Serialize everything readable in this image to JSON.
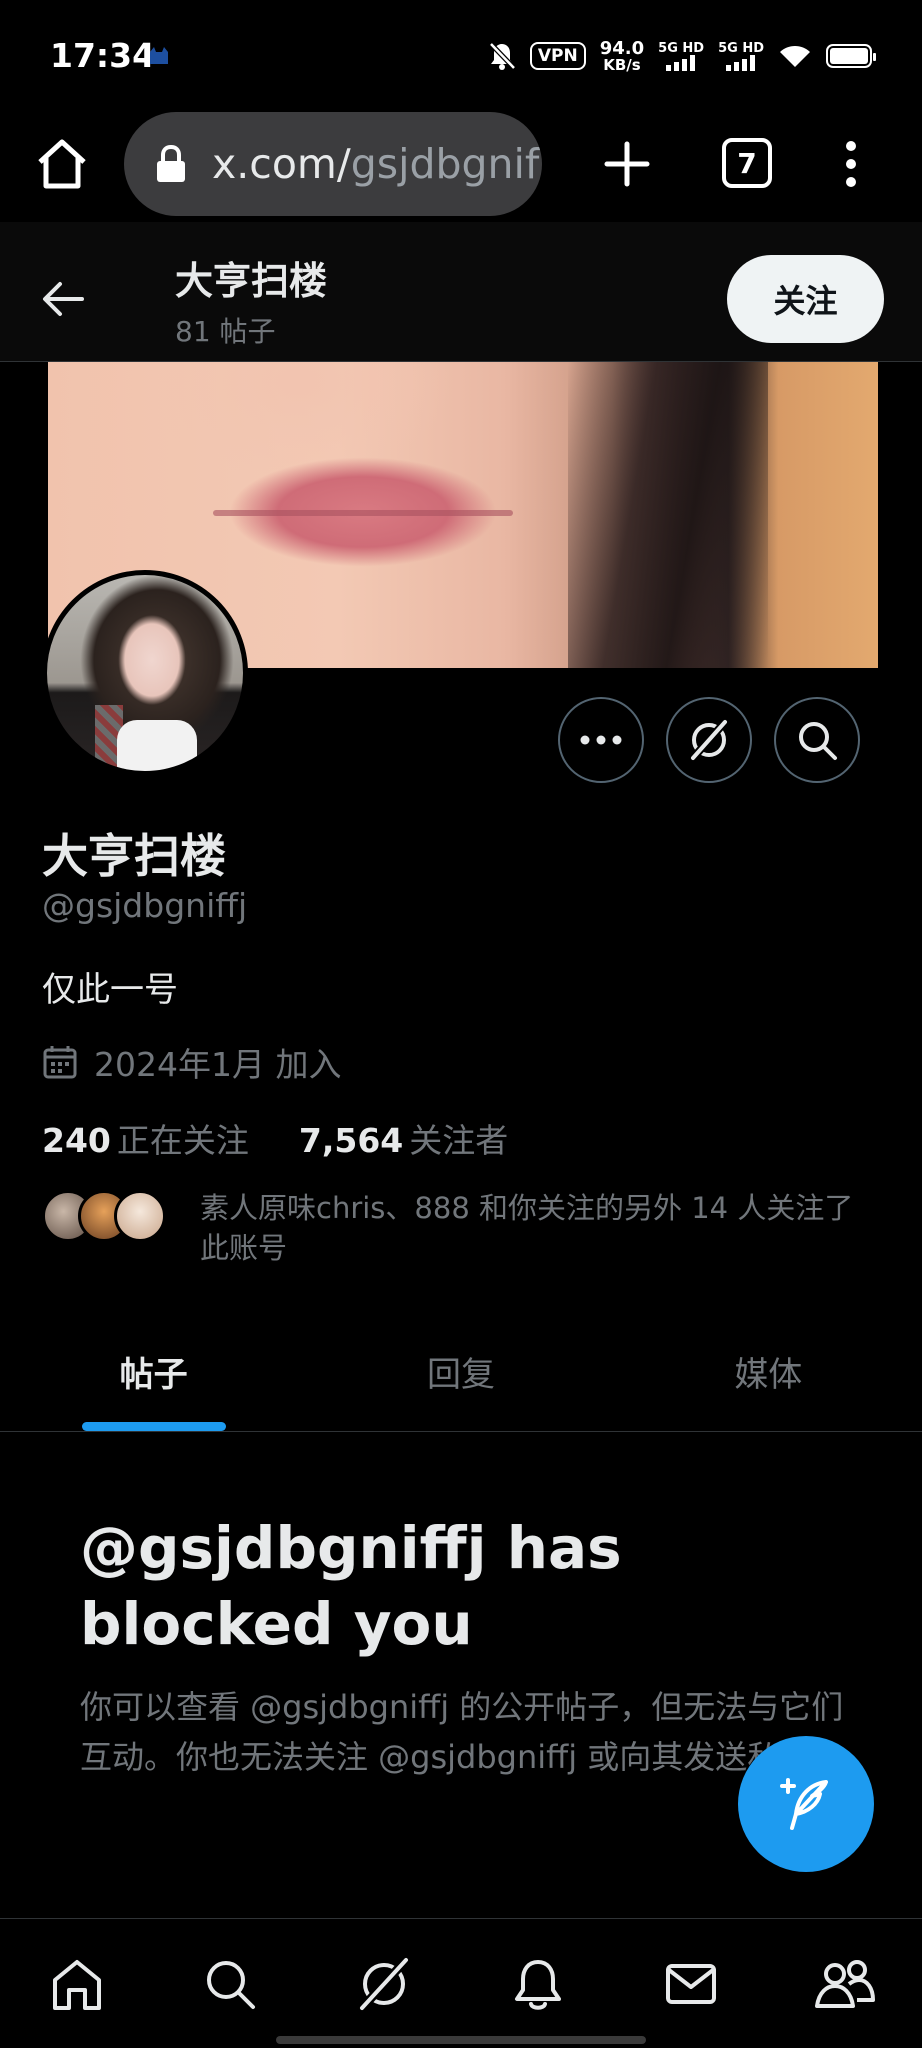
{
  "status_bar": {
    "time": "17:34",
    "vpn": "VPN",
    "speed_value": "94.0",
    "speed_unit": "KB/s",
    "signal1": "5G HD",
    "signal2": "5G HD"
  },
  "browser": {
    "url_host": "x.com/",
    "url_path": "gsjdbgnif",
    "tab_count": "7"
  },
  "header": {
    "name": "大亨扫楼",
    "posts_count": "81 帖子",
    "follow_label": "关注"
  },
  "profile": {
    "name": "大亨扫楼",
    "handle": "@gsjdbgniffj",
    "bio": "仅此一号",
    "joined": "2024年1月 加入",
    "following_count": "240",
    "following_label": "正在关注",
    "followers_count": "7,564",
    "followers_label": "关注者",
    "followed_by_text": "素人原味chris、888 和你关注的另外 14 人关注了此账号"
  },
  "tabs": [
    {
      "label": "帖子",
      "active": true
    },
    {
      "label": "回复",
      "active": false
    },
    {
      "label": "媒体",
      "active": false
    }
  ],
  "blocked": {
    "title": "@gsjdbgniffj has blocked you",
    "description": "你可以查看 @gsjdbgniffj 的公开帖子，但无法与它们互动。你也无法关注 @gsjdbgniffj 或向其发送私信。"
  },
  "icons": {
    "home": "home-icon",
    "search": "search-icon",
    "grok": "grok-icon",
    "notifications": "bell-icon",
    "messages": "mail-icon",
    "communities": "people-icon",
    "compose": "compose-icon"
  },
  "colors": {
    "accent": "#1d9bf0",
    "background": "#000000",
    "text_primary": "#e7e9ea",
    "text_secondary": "#71767b"
  }
}
